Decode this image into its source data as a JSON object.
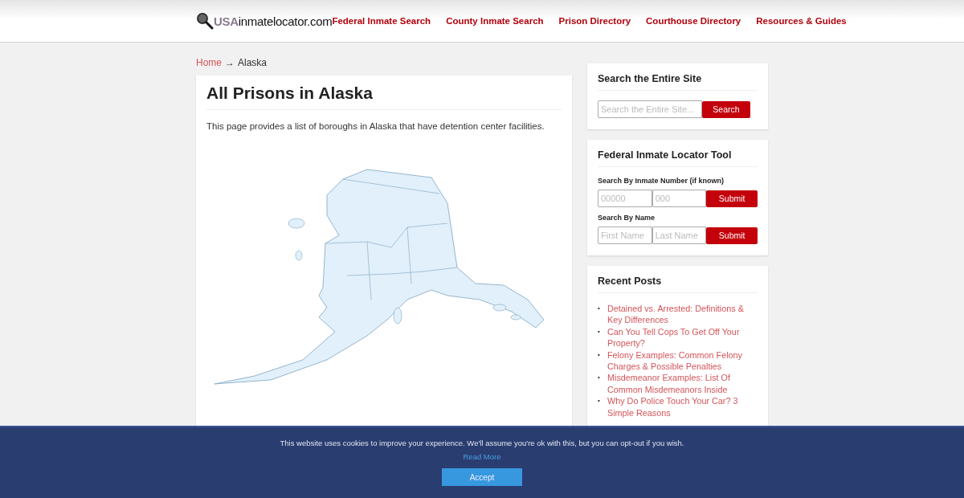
{
  "header": {
    "logo": {
      "prefix": "USA",
      "name": "inmatelocator.com"
    },
    "nav": [
      "Federal Inmate Search",
      "County Inmate Search",
      "Prison Directory",
      "Courthouse Directory",
      "Resources & Guides"
    ]
  },
  "breadcrumb": {
    "home": "Home",
    "separator": "→",
    "current": "Alaska"
  },
  "article": {
    "title": "All Prisons in Alaska",
    "intro": "This page provides a list of boroughs in Alaska that have detention center facilities."
  },
  "sidebar": {
    "site_search": {
      "title": "Search the Entire Site",
      "placeholder": "Search the Entire Site...",
      "button": "Search"
    },
    "locator": {
      "title": "Federal Inmate Locator Tool",
      "sections": [
        {
          "label": "Search By Inmate Number (if known)",
          "fields": [
            {
              "placeholder": "00000"
            },
            {
              "placeholder": "000"
            }
          ],
          "button": "Submit"
        },
        {
          "label": "Search By Name",
          "fields": [
            {
              "placeholder": "First Name"
            },
            {
              "placeholder": "Last Name"
            }
          ],
          "button": "Submit"
        }
      ]
    },
    "recent_posts": {
      "title": "Recent Posts",
      "posts": [
        {
          "marker": "•",
          "title": "Detained vs. Arrested: Definitions & Key Differences"
        },
        {
          "marker": "•",
          "title": "Can You Tell Cops To Get Off Your Property?"
        },
        {
          "marker": "•",
          "title": "Felony Examples: Common Felony Charges & Possible Penalties"
        },
        {
          "marker": "•",
          "title": "Misdemeanor Examples: List Of Common Misdemeanors Inside"
        },
        {
          "marker": "•",
          "title": "Why Do Police Touch Your Car? 3 Simple Reasons"
        }
      ]
    }
  },
  "cookie_bar": {
    "message": "This website uses cookies to improve your experience. We'll assume you're ok with this, but you can opt-out if you wish.",
    "link": "Read More",
    "button": "Accept"
  }
}
